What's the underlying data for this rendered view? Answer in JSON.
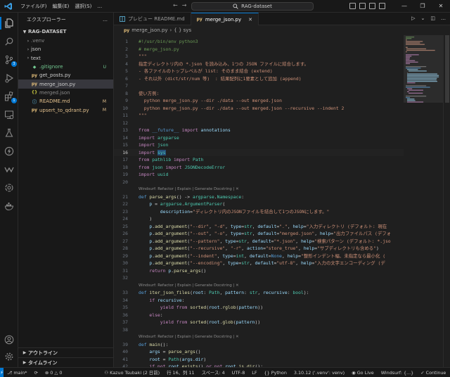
{
  "title_bar": {
    "menus": [
      "ファイル(F)",
      "編集(E)",
      "選択(S)",
      "…"
    ],
    "search_text": "RAG-dataset",
    "window_controls": [
      "—",
      "❐",
      "✕"
    ]
  },
  "activity_bar": {
    "items": [
      {
        "name": "explorer-icon",
        "badge": ""
      },
      {
        "name": "search-icon",
        "badge": ""
      },
      {
        "name": "source-control-icon",
        "badge": "3"
      },
      {
        "name": "run-debug-icon",
        "badge": ""
      },
      {
        "name": "extensions-icon",
        "badge": "1"
      },
      {
        "name": "remote-explorer-icon",
        "badge": ""
      },
      {
        "name": "testing-icon",
        "badge": ""
      },
      {
        "name": "thunder-icon",
        "badge": ""
      },
      {
        "name": "windsurf-icon",
        "badge": ""
      },
      {
        "name": "openai-icon",
        "badge": ""
      },
      {
        "name": "docker-icon",
        "badge": ""
      }
    ],
    "bottom": [
      "account-icon",
      "manage-gear-icon"
    ]
  },
  "sidebar": {
    "title": "エクスプローラー",
    "more": "…",
    "folder": "RAG-DATASET",
    "items": [
      {
        "type": "folder",
        "label": ".venv",
        "icon": "",
        "status": "",
        "color": "c-dim"
      },
      {
        "type": "folder",
        "label": "json",
        "icon": "",
        "status": "",
        "color": ""
      },
      {
        "type": "folder",
        "label": "text",
        "icon": "",
        "status": "",
        "color": ""
      },
      {
        "type": "file",
        "label": ".gitignore",
        "icon": "◆",
        "status": "U",
        "color": "c-untracked",
        "icolor": "c-git"
      },
      {
        "type": "file",
        "label": "get_posts.py",
        "icon": "py",
        "status": "",
        "color": "",
        "icolor": "c-py"
      },
      {
        "type": "file",
        "label": "merge_json.py",
        "icon": "py",
        "status": "",
        "color": "",
        "icolor": "c-py",
        "selected": true
      },
      {
        "type": "file",
        "label": "merged.json",
        "icon": "{}",
        "status": "",
        "color": "c-dim",
        "icolor": "c-json"
      },
      {
        "type": "file",
        "label": "README.md",
        "icon": "ⓘ",
        "status": "M",
        "color": "c-mod",
        "icolor": "c-md"
      },
      {
        "type": "file",
        "label": "upsert_to_qdrant.py",
        "icon": "py",
        "status": "M",
        "color": "c-mod",
        "icolor": "c-py"
      }
    ],
    "outline": "アウトライン",
    "timeline": "タイムライン"
  },
  "tabs": [
    {
      "label": "プレビュー README.md",
      "active": false
    },
    {
      "label": "merge_json.py",
      "active": true
    }
  ],
  "breadcrumb": [
    "merge_json.py",
    "{ } sys"
  ],
  "editor": {
    "lines": [
      {
        "n": "1",
        "html": "<span class='cm'>#!/usr/bin/env python3</span>"
      },
      {
        "n": "2",
        "html": "<span class='cm'># merge_json.py</span>"
      },
      {
        "n": "3",
        "html": "<span class='str'>\"\"\"</span>"
      },
      {
        "n": "4",
        "html": "<span class='str'>指定ディレクトリ内の *.json を読み込み、1つの JSON ファイルに結合します。</span>"
      },
      {
        "n": "5",
        "html": "<span class='str'>- 各ファイルのトップレベルが list: そのまま結合 (extend)</span>"
      },
      {
        "n": "6",
        "html": "<span class='str'>- それ以外 (dict/str/num 等)  : 結果配列に1要素として追加 (append)</span>"
      },
      {
        "n": "7",
        "html": ""
      },
      {
        "n": "8",
        "html": "<span class='str'>使い方例:</span>"
      },
      {
        "n": "9",
        "html": "<span class='str'>  python merge_json.py --dir ./data --out merged.json</span>"
      },
      {
        "n": "10",
        "html": "<span class='str'>  python merge_json.py --dir ./data --out merged.json --recursive --indent 2</span>"
      },
      {
        "n": "11",
        "html": "<span class='str'>\"\"\"</span>"
      },
      {
        "n": "12",
        "html": ""
      },
      {
        "n": "13",
        "html": "<span class='kw'>from</span> <span class='kw2'>__future__</span> <span class='kw'>import</span> <span class='var'>annotations</span>"
      },
      {
        "n": "14",
        "html": "<span class='kw'>import</span> <span class='ty'>argparse</span>"
      },
      {
        "n": "15",
        "html": "<span class='kw'>import</span> <span class='ty'>json</span>"
      },
      {
        "n": "16",
        "html": "<span class='kw'>import</span> <span class='ty sel'>sys</span>",
        "cur": true
      },
      {
        "n": "17",
        "html": "<span class='kw'>from</span> <span class='ty'>pathlib</span> <span class='kw'>import</span> <span class='ty'>Path</span>"
      },
      {
        "n": "18",
        "html": "<span class='kw'>from</span> <span class='ty'>json</span> <span class='kw'>import</span> <span class='ty'>JSONDecodeError</span>"
      },
      {
        "n": "19",
        "html": "<span class='kw'>import</span> <span class='ty'>uuid</span>"
      },
      {
        "n": "20",
        "html": ""
      },
      {
        "n": "",
        "lens": true,
        "html": "Windsurf: Refactor | Explain | Generate Docstring | ✕"
      },
      {
        "n": "21",
        "html": "<span class='kw2'>def</span> <span class='fn'>parse_args</span>() -&gt; <span class='ty'>argparse</span>.<span class='ty'>Namespace</span>:"
      },
      {
        "n": "22",
        "html": "    <span class='var'>p</span> = <span class='ty'>argparse</span>.<span class='ty'>ArgumentParser</span>("
      },
      {
        "n": "23",
        "html": "        <span class='var'>description</span>=<span class='str'>\"ディレクトリ内のJSONファイルを結合して1つのJSONにします。\"</span>"
      },
      {
        "n": "24",
        "html": "    )"
      },
      {
        "n": "25",
        "html": "    <span class='var'>p</span>.<span class='fn'>add_argument</span>(<span class='str'>\"--dir\"</span>, <span class='str'>\"-d\"</span>, <span class='var'>type</span>=<span class='ty'>str</span>, <span class='var'>default</span>=<span class='str'>\".\"</span>, <span class='var'>help</span>=<span class='str'>\"入力ディレクトリ (デフォルト: 現在</span>"
      },
      {
        "n": "26",
        "html": "    <span class='var'>p</span>.<span class='fn'>add_argument</span>(<span class='str'>\"--out\"</span>, <span class='str'>\"-o\"</span>, <span class='var'>type</span>=<span class='ty'>str</span>, <span class='var'>default</span>=<span class='str'>\"merged.json\"</span>, <span class='var'>help</span>=<span class='str'>\"出力ファイルパス (デフォ</span>"
      },
      {
        "n": "27",
        "html": "    <span class='var'>p</span>.<span class='fn'>add_argument</span>(<span class='str'>\"--pattern\"</span>, <span class='var'>type</span>=<span class='ty'>str</span>, <span class='var'>default</span>=<span class='str'>\"*.json\"</span>, <span class='var'>help</span>=<span class='str'>\"検索パターン (デフォルト: *.jso</span>"
      },
      {
        "n": "28",
        "html": "    <span class='var'>p</span>.<span class='fn'>add_argument</span>(<span class='str'>\"--recursive\"</span>, <span class='str'>\"-r\"</span>, <span class='var'>action</span>=<span class='str'>\"store_true\"</span>, <span class='var'>help</span>=<span class='str'>\"サブディレクトリも含める\"</span>)"
      },
      {
        "n": "29",
        "html": "    <span class='var'>p</span>.<span class='fn'>add_argument</span>(<span class='str'>\"--indent\"</span>, <span class='var'>type</span>=<span class='ty'>int</span>, <span class='var'>default</span>=<span class='kw2'>None</span>, <span class='var'>help</span>=<span class='str'>\"整形インデント幅、未指定なら最小化 (</span>"
      },
      {
        "n": "30",
        "html": "    <span class='var'>p</span>.<span class='fn'>add_argument</span>(<span class='str'>\"--encoding\"</span>, <span class='var'>type</span>=<span class='ty'>str</span>, <span class='var'>default</span>=<span class='str'>\"utf-8\"</span>, <span class='var'>help</span>=<span class='str'>\"入力の文字エンコーディング (デ</span>"
      },
      {
        "n": "31",
        "html": "    <span class='kw'>return</span> <span class='var'>p</span>.<span class='fn'>parse_args</span>()"
      },
      {
        "n": "32",
        "html": ""
      },
      {
        "n": "",
        "lens": true,
        "html": "Windsurf: Refactor | Explain | Generate Docstring | ✕"
      },
      {
        "n": "33",
        "html": "<span class='kw2'>def</span> <span class='fn'>iter_json_files</span>(<span class='var'>root</span>: <span class='ty'>Path</span>, <span class='var'>pattern</span>: <span class='ty'>str</span>, <span class='var'>recursive</span>: <span class='ty'>bool</span>):"
      },
      {
        "n": "34",
        "html": "    <span class='kw'>if</span> <span class='var'>recursive</span>:"
      },
      {
        "n": "35",
        "html": "        <span class='kw'>yield from</span> <span class='fn'>sorted</span>(<span class='var'>root</span>.<span class='fn'>rglob</span>(<span class='var'>pattern</span>))"
      },
      {
        "n": "36",
        "html": "    <span class='kw'>else</span>:"
      },
      {
        "n": "37",
        "html": "        <span class='kw'>yield from</span> <span class='fn'>sorted</span>(<span class='var'>root</span>.<span class='fn'>glob</span>(<span class='var'>pattern</span>))"
      },
      {
        "n": "38",
        "html": ""
      },
      {
        "n": "",
        "lens": true,
        "html": "Windsurf: Refactor | Explain | Generate Docstring | ✕"
      },
      {
        "n": "39",
        "html": "<span class='kw2'>def</span> <span class='fn'>main</span>():"
      },
      {
        "n": "40",
        "html": "    <span class='var'>args</span> = <span class='fn'>parse_args</span>()"
      },
      {
        "n": "41",
        "html": "    <span class='var'>root</span> = <span class='ty'>Path</span>(<span class='var'>args</span>.<span class='var'>dir</span>)"
      },
      {
        "n": "42",
        "html": "    <span class='kw'>if not</span> <span class='var'>root</span>.<span class='fn'>exists</span>() <span class='kw'>or not</span> <span class='var'>root</span>.<span class='fn'>is_dir</span>():"
      }
    ]
  },
  "status_bar": {
    "branch": "main*",
    "sync": "⟳",
    "problems_errors": "0",
    "problems_warnings": "0",
    "author": "Kazuo Tsubaki (2 日前)",
    "cursor": "行 16、列 11",
    "spaces": "スペース: 4",
    "encoding": "UTF-8",
    "eol": "LF",
    "language": "Python",
    "interpreter": "3.10.12 ('.venv': venv)",
    "golive": "Go Live",
    "windsurf": "Windsurf: {...}",
    "continue": "Continue",
    "accent": "#0078d4"
  }
}
